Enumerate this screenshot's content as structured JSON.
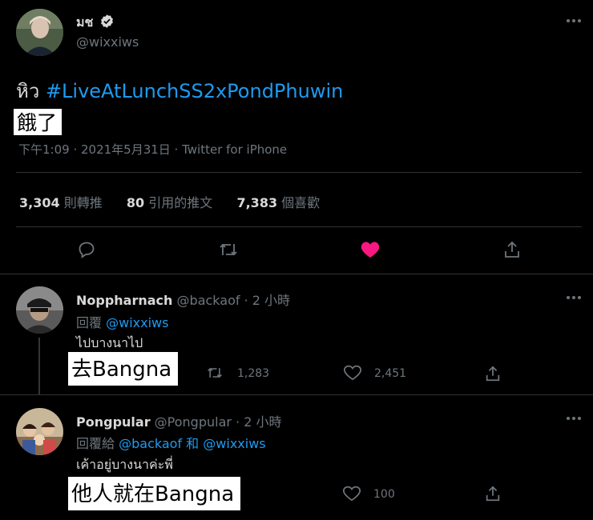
{
  "main_tweet": {
    "display_name": "มช",
    "handle": "@wixxiws",
    "text_thai": "หิว",
    "hashtag": "#LiveAtLunchSS2xPondPhuwin",
    "caption": "餓了",
    "meta": "下午1:09 · 2021年5月31日 · Twitter for iPhone",
    "stats": {
      "retweets_count": "3,304",
      "retweets_label": "則轉推",
      "quotes_count": "80",
      "quotes_label": "引用的推文",
      "likes_count": "7,383",
      "likes_label": "個喜歡"
    }
  },
  "replies": [
    {
      "display_name": "Noppharnach",
      "handle": "@backaof",
      "time": "· 2 小時",
      "replying_prefix": "回覆",
      "replying_to": "@wixxiws",
      "replying_and": "",
      "replying_to_2": "",
      "text": "ไปบางนาไป",
      "caption": "去Bangna",
      "retweets": "1,283",
      "likes": "2,451"
    },
    {
      "display_name": "Pongpular",
      "handle": "@Pongpular",
      "time": "· 2 小時",
      "replying_prefix": "回覆給",
      "replying_to": "@backaof",
      "replying_and": "和",
      "replying_to_2": "@wixxiws",
      "text": "เค้าอยู่บางนาค่ะพี่",
      "caption": "他人就在Bangna",
      "retweets": "",
      "likes": "100"
    }
  ],
  "colors": {
    "background": "#000000",
    "link": "#1d9bf0",
    "like": "#f91880",
    "muted": "#6e767d"
  }
}
